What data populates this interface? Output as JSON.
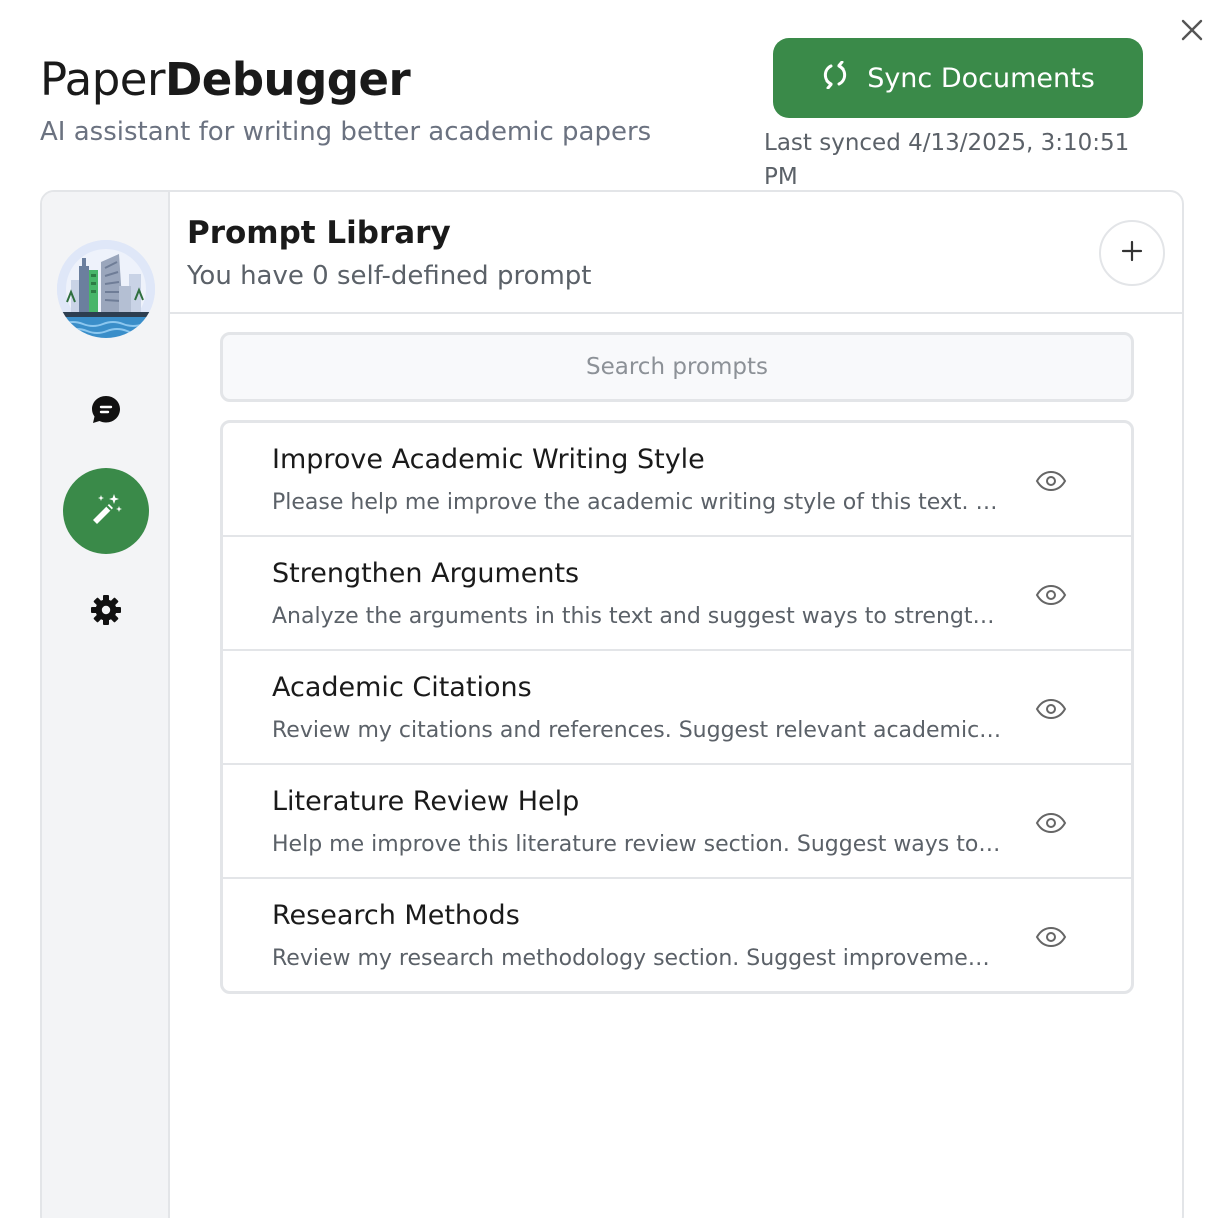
{
  "window": {
    "close_icon": "close-icon"
  },
  "header": {
    "brand_light": "Paper",
    "brand_bold": "Debugger",
    "tagline": "AI assistant for writing better academic papers",
    "sync_button": {
      "label": "Sync Documents",
      "icon": "sync-icon",
      "color": "#3a8a49"
    },
    "last_synced": "Last synced 4/13/2025, 3:10:51 PM"
  },
  "sidebar": {
    "avatar": "city-skyline-avatar",
    "items": [
      {
        "name": "chat",
        "icon": "chat-bubble-icon",
        "active": false
      },
      {
        "name": "prompts",
        "icon": "magic-wand-icon",
        "active": true
      },
      {
        "name": "settings",
        "icon": "gear-icon",
        "active": false
      }
    ],
    "active_color": "#3a8a49"
  },
  "library": {
    "title": "Prompt Library",
    "subtitle": "You have 0 self-defined prompt",
    "add_icon": "plus-icon",
    "search_placeholder": "Search prompts",
    "prompts": [
      {
        "title": "Improve Academic Writing Style",
        "description": "Please help me improve the academic writing style of this text. …",
        "icon": "eye-icon"
      },
      {
        "title": "Strengthen Arguments",
        "description": "Analyze the arguments in this text and suggest ways to strengt…",
        "icon": "eye-icon"
      },
      {
        "title": "Academic Citations",
        "description": "Review my citations and references. Suggest relevant academic…",
        "icon": "eye-icon"
      },
      {
        "title": "Literature Review Help",
        "description": "Help me improve this literature review section. Suggest ways to…",
        "icon": "eye-icon"
      },
      {
        "title": "Research Methods",
        "description": "Review my research methodology section. Suggest improveme…",
        "icon": "eye-icon"
      }
    ]
  }
}
